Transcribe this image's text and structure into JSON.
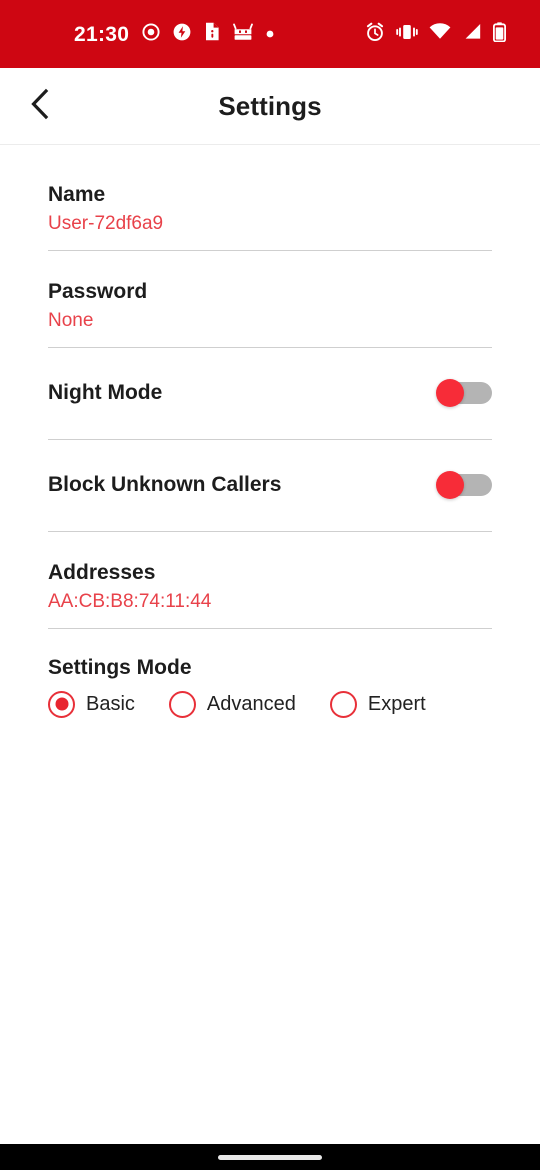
{
  "status_bar": {
    "time": "21:30",
    "background_color": "#CE0612",
    "left_icons": [
      {
        "name": "record-circle-icon"
      },
      {
        "name": "flash-circle-icon"
      },
      {
        "name": "file-document-icon"
      },
      {
        "name": "android-robot-icon"
      },
      {
        "name": "dot-indicator-icon"
      }
    ],
    "right_icons": [
      {
        "name": "alarm-clock-icon"
      },
      {
        "name": "vibrate-icon"
      },
      {
        "name": "wifi-icon"
      },
      {
        "name": "cell-signal-icon"
      },
      {
        "name": "battery-icon"
      }
    ]
  },
  "app_bar": {
    "back_label": "‹",
    "title": "Settings",
    "ghost_artifact": ""
  },
  "settings": {
    "name": {
      "label": "Name",
      "value": "User-72df6a9"
    },
    "password": {
      "label": "Password",
      "value": "None"
    },
    "night_mode": {
      "label": "Night Mode",
      "state": "off"
    },
    "block_unknown_callers": {
      "label": "Block Unknown Callers",
      "state": "off"
    },
    "addresses": {
      "label": "Addresses",
      "value": "AA:CB:B8:74:11:44"
    },
    "settings_mode": {
      "label": "Settings Mode",
      "selected": "Basic",
      "options": [
        {
          "label": "Basic",
          "checked": true
        },
        {
          "label": "Advanced",
          "checked": false
        },
        {
          "label": "Expert",
          "checked": false
        }
      ]
    }
  },
  "colors": {
    "status_bar_red": "#CE0612",
    "value_text_red": "#E8424A",
    "toggle_thumb_red": "#F72C38",
    "toggle_track_gray": "#B4B4B4",
    "radio_red": "#E83039",
    "divider_gray": "#CFCFCF",
    "title_dark": "#1D1D1D",
    "nav_bar_black": "#000000"
  }
}
